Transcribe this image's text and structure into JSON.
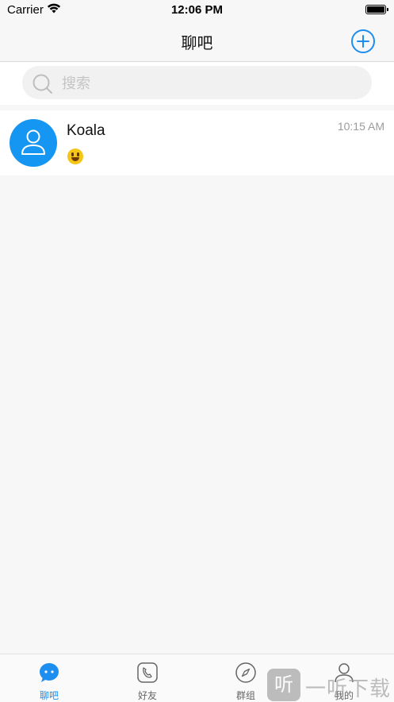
{
  "status_bar": {
    "carrier": "Carrier",
    "time": "12:06 PM"
  },
  "nav": {
    "title": "聊吧"
  },
  "search": {
    "placeholder": "搜索"
  },
  "chats": [
    {
      "name": "Koala",
      "time": "10:15 AM",
      "message": "😃"
    }
  ],
  "tabs": [
    {
      "label": "聊吧",
      "icon": "chat-bubble-icon",
      "active": true
    },
    {
      "label": "好友",
      "icon": "phone-icon",
      "active": false
    },
    {
      "label": "群组",
      "icon": "compass-icon",
      "active": false
    },
    {
      "label": "我的",
      "icon": "person-icon",
      "active": false
    }
  ],
  "watermark": {
    "logo_text": "听",
    "text": "一听下载"
  },
  "colors": {
    "accent": "#1b8ef0",
    "avatar": "#1596f2",
    "background": "#f7f7f7"
  }
}
